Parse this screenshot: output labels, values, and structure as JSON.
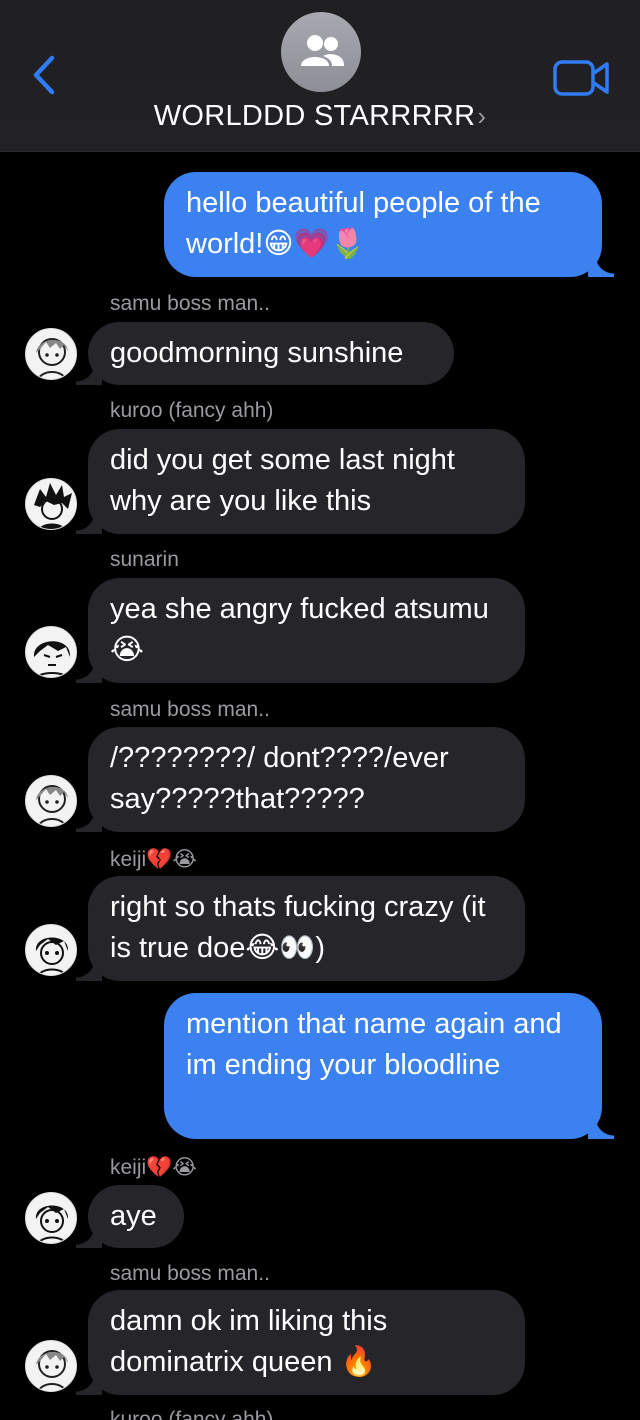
{
  "header": {
    "title": "WORLDDD STARRRRR",
    "title_chevron": "›",
    "back_icon": "chevron-left-icon",
    "video_icon": "video-camera-icon",
    "group_icon": "group-people-icon"
  },
  "colors": {
    "outgoing_bubble": "#3b82f0",
    "incoming_bubble": "#26262a",
    "accent": "#2f7cf6",
    "sender_name": "#9a9aa0"
  },
  "messages": [
    {
      "direction": "outgoing",
      "text": "hello beautiful people of the world!😁💗🌷"
    },
    {
      "direction": "incoming",
      "sender": "samu boss man..",
      "text": "goodmorning sunshine"
    },
    {
      "direction": "incoming",
      "sender": "kuroo (fancy ahh)",
      "text": "did you get some last night why are you like this"
    },
    {
      "direction": "incoming",
      "sender": "sunarin",
      "text": "yea she angry fucked atsumu😭"
    },
    {
      "direction": "incoming",
      "sender": "samu boss man..",
      "text": "/????????/ dont????/ever say?????that?????"
    },
    {
      "direction": "incoming",
      "sender": "keiji💔😭",
      "text": "right so thats fucking crazy (it is true doe😂👀)"
    },
    {
      "direction": "outgoing",
      "text": "mention that name again and im ending your bloodline"
    },
    {
      "direction": "incoming",
      "sender": "keiji💔😭",
      "text": "aye"
    },
    {
      "direction": "incoming",
      "sender": "samu boss man..",
      "text": "damn ok im liking this dominatrix queen 🔥"
    },
    {
      "direction": "incoming",
      "sender": "kuroo (fancy ahh)",
      "text": ""
    }
  ]
}
